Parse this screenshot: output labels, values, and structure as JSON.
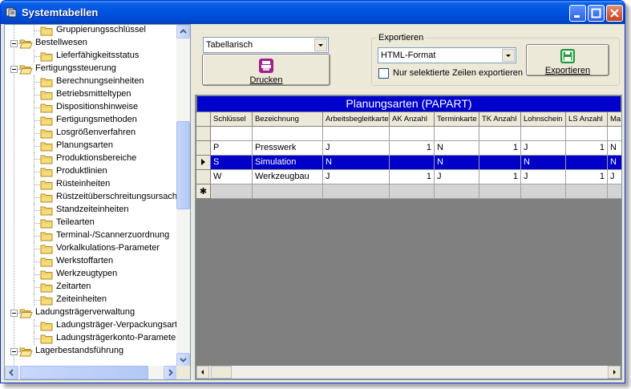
{
  "window": {
    "title": "Systemtabellen"
  },
  "tree": {
    "items": [
      {
        "label": "Gruppierungsschlüssel",
        "level": 2,
        "expander": false
      },
      {
        "label": "Bestellwesen",
        "level": 1,
        "expander": true
      },
      {
        "label": "Lieferfähigkeitsstatus",
        "level": 2,
        "expander": false
      },
      {
        "label": "Fertigungssteuerung",
        "level": 1,
        "expander": true
      },
      {
        "label": "Berechnungseinheiten",
        "level": 2,
        "expander": false
      },
      {
        "label": "Betriebsmitteltypen",
        "level": 2,
        "expander": false
      },
      {
        "label": "Dispositionshinweise",
        "level": 2,
        "expander": false
      },
      {
        "label": "Fertigungsmethoden",
        "level": 2,
        "expander": false
      },
      {
        "label": "Losgrößenverfahren",
        "level": 2,
        "expander": false
      },
      {
        "label": "Planungsarten",
        "level": 2,
        "expander": false
      },
      {
        "label": "Produktionsbereiche",
        "level": 2,
        "expander": false
      },
      {
        "label": "Produktlinien",
        "level": 2,
        "expander": false
      },
      {
        "label": "Rüsteinheiten",
        "level": 2,
        "expander": false
      },
      {
        "label": "Rüstzeitüberschreitungsursache",
        "level": 2,
        "expander": false
      },
      {
        "label": "Standzeiteinheiten",
        "level": 2,
        "expander": false
      },
      {
        "label": "Teilearten",
        "level": 2,
        "expander": false
      },
      {
        "label": "Terminal-/Scannerzuordnung",
        "level": 2,
        "expander": false
      },
      {
        "label": "Vorkalkulations-Parameter",
        "level": 2,
        "expander": false
      },
      {
        "label": "Werkstoffarten",
        "level": 2,
        "expander": false
      },
      {
        "label": "Werkzeugtypen",
        "level": 2,
        "expander": false
      },
      {
        "label": "Zeitarten",
        "level": 2,
        "expander": false
      },
      {
        "label": "Zeiteinheiten",
        "level": 2,
        "expander": false
      },
      {
        "label": "Ladungsträgerverwaltung",
        "level": 1,
        "expander": true
      },
      {
        "label": "Ladungsträger-Verpackungsarte",
        "level": 2,
        "expander": false
      },
      {
        "label": "Ladungsträgerkonto-Parameter",
        "level": 2,
        "expander": false
      },
      {
        "label": "Lagerbestandsführung",
        "level": 1,
        "expander": true
      }
    ]
  },
  "view_select": {
    "value": "Tabellarisch"
  },
  "print_button": {
    "label": "Drucken"
  },
  "export": {
    "group_label": "Exportieren",
    "format_value": "HTML-Format",
    "only_selected_label": "Nur selektierte Zeilen exportieren",
    "only_selected_checked": false,
    "button_label": "Exportieren"
  },
  "grid": {
    "caption": "Planungsarten (PAPART)",
    "columns": [
      "Schlüssel",
      "Bezeichnung",
      "Arbeitsbegleitkarte",
      "AK Anzahl",
      "Terminkarte",
      "TK Anzahl",
      "Lohnschein",
      "LS Anzahl",
      "Ma"
    ],
    "rows": [
      [
        "",
        "",
        "",
        "",
        "",
        "",
        "",
        "",
        ""
      ],
      [
        "P",
        "Presswerk",
        "J",
        "1",
        "N",
        "1",
        "J",
        "1",
        "N"
      ],
      [
        "S",
        "Simulation",
        "N",
        "",
        "N",
        "",
        "N",
        "",
        "N"
      ],
      [
        "W",
        "Werkzeugbau",
        "J",
        "1",
        "J",
        "1",
        "J",
        "1",
        "J"
      ]
    ],
    "selected_row": 2,
    "new_row_marker": "✱",
    "current_row_marker": "▶"
  },
  "colors": {
    "title_bar": "#0054e3",
    "grid_caption": "#0000cc",
    "selected_row": "#0000c8",
    "grid_background": "#808080"
  }
}
